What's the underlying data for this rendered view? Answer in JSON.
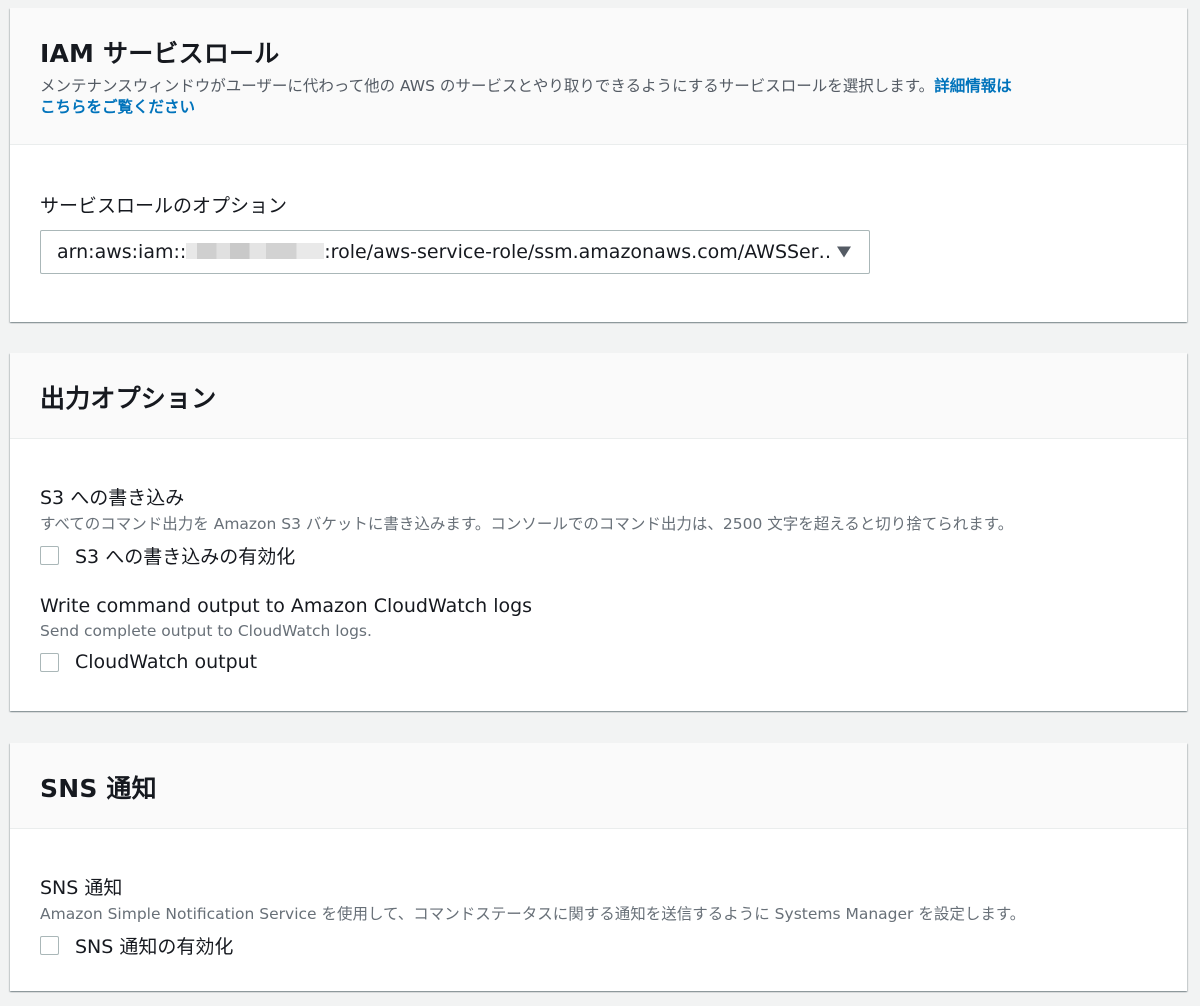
{
  "iam_panel": {
    "title": "IAM サービスロール",
    "description": "メンテナンスウィンドウがユーザーに代わって他の AWS のサービスとやり取りできるようにするサービスロールを選択します。",
    "link_part1": "詳細情報は",
    "link_part2": "こちらをご覧ください",
    "field_label": "サービスロールのオプション",
    "select_value_prefix": "arn:aws:iam::",
    "select_value_suffix": ":role/aws-service-role/ssm.amazonaws.com/AWSSer…"
  },
  "output_panel": {
    "title": "出力オプション",
    "s3": {
      "label": "S3 への書き込み",
      "description": "すべてのコマンド出力を Amazon S3 バケットに書き込みます。コンソールでのコマンド出力は、2500 文字を超えると切り捨てられます。",
      "checkbox_label": "S3 への書き込みの有効化",
      "checked": false
    },
    "cloudwatch": {
      "label": "Write command output to Amazon CloudWatch logs",
      "description": "Send complete output to CloudWatch logs.",
      "checkbox_label": "CloudWatch output",
      "checked": false
    }
  },
  "sns_panel": {
    "title": "SNS 通知",
    "label": "SNS 通知",
    "description": "Amazon Simple Notification Service を使用して、コマンドステータスに関する通知を送信するように Systems Manager を設定します。",
    "checkbox_label": "SNS 通知の有効化",
    "checked": false
  },
  "colors": {
    "link": "#0073bb",
    "page_background": "#f2f3f3",
    "header_background": "#fafafa"
  },
  "icons": {
    "select_caret": "caret-down-icon",
    "redaction": "redacted-account-id"
  }
}
